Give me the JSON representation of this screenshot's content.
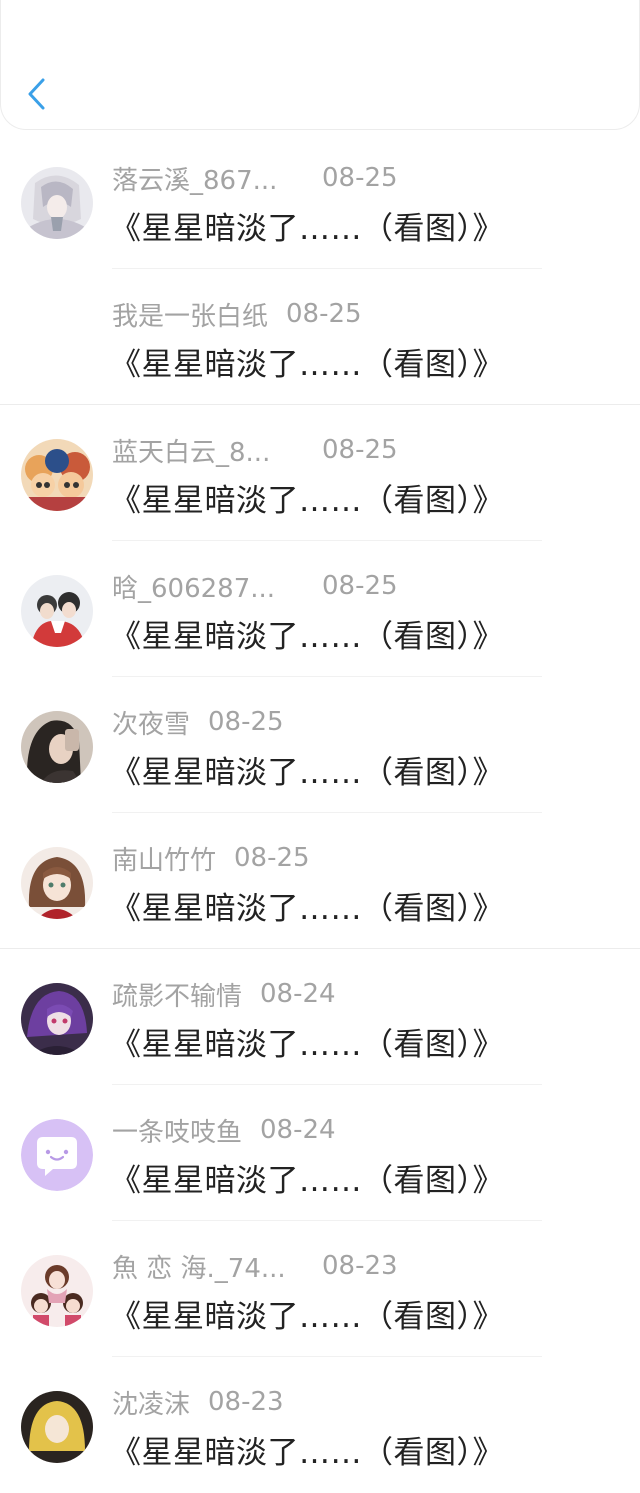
{
  "header": {
    "back_icon": "chevron-left-icon",
    "accent": "#3aa0e8"
  },
  "items": [
    {
      "name": "落云溪_867...",
      "date": "08-25",
      "title": "《星星暗淡了……（看图）》",
      "avatar": "anime-silver-hair",
      "has_avatar": true
    },
    {
      "name": "我是一张白纸",
      "date": "08-25",
      "title": "《星星暗淡了……（看图）》",
      "avatar": "",
      "has_avatar": false
    },
    {
      "name": "蓝天白云_8...",
      "date": "08-25",
      "title": "《星星暗淡了……（看图）》",
      "avatar": "cartoon-group",
      "has_avatar": true
    },
    {
      "name": "晗_606287...",
      "date": "08-25",
      "title": "《星星暗淡了……（看图）》",
      "avatar": "couple-red",
      "has_avatar": true
    },
    {
      "name": "次夜雪",
      "date": "08-25",
      "title": "《星星暗淡了……（看图）》",
      "avatar": "dark-hair-girl",
      "has_avatar": true
    },
    {
      "name": "南山竹竹",
      "date": "08-25",
      "title": "《星星暗淡了……（看图）》",
      "avatar": "anime-brown-hair",
      "has_avatar": true
    },
    {
      "name": "疏影不输情",
      "date": "08-24",
      "title": "《星星暗淡了……（看图）》",
      "avatar": "anime-purple",
      "has_avatar": true
    },
    {
      "name": "一条吱吱鱼",
      "date": "08-24",
      "title": "《星星暗淡了……（看图）》",
      "avatar": "chat-bubble-lavender",
      "has_avatar": true
    },
    {
      "name": "魚 恋 海._74...",
      "date": "08-23",
      "title": "《星星暗淡了……（看图）》",
      "avatar": "cartoon-family",
      "has_avatar": true
    },
    {
      "name": "沈凌沫",
      "date": "08-23",
      "title": "《星星暗淡了……（看图）》",
      "avatar": "anime-blonde",
      "has_avatar": true
    }
  ]
}
